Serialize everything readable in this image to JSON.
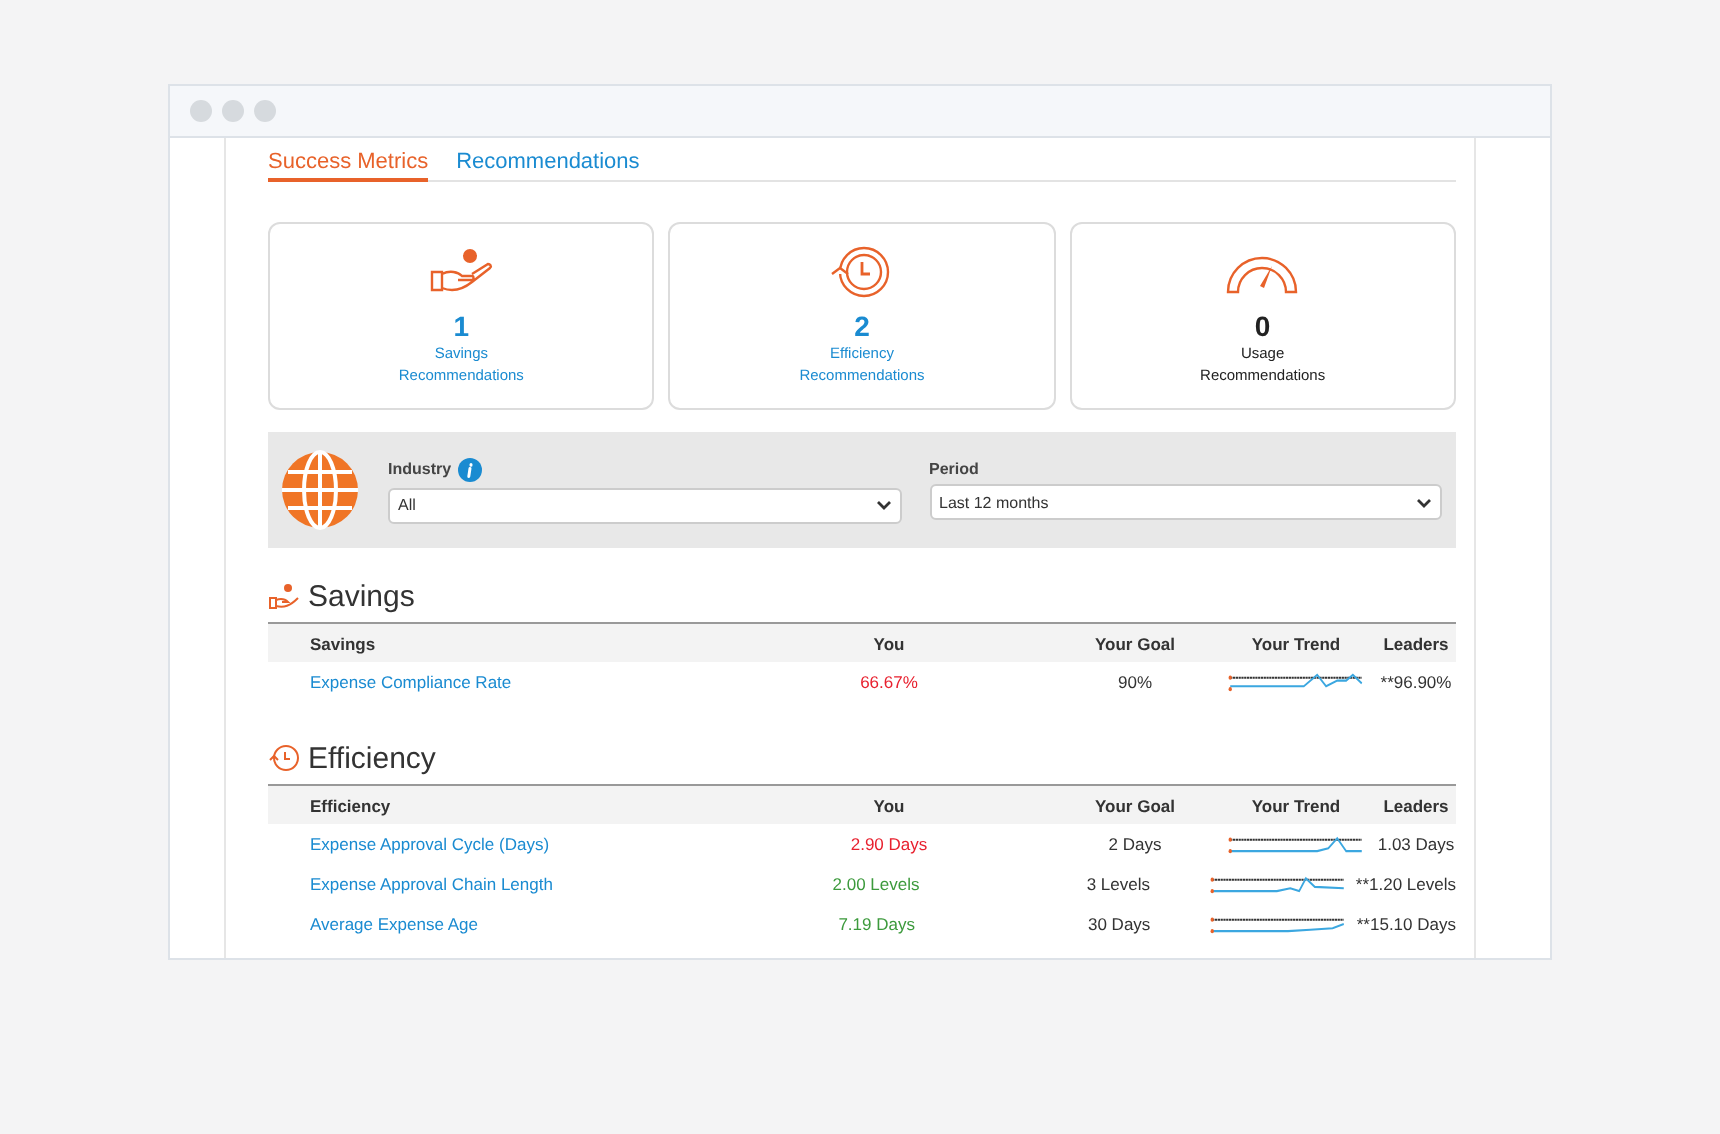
{
  "tabs": [
    {
      "label": "Success Metrics",
      "selected": true
    },
    {
      "label": "Recommendations",
      "selected": false
    }
  ],
  "cards": [
    {
      "kind": "savings",
      "count": "1",
      "line1": "Savings",
      "line2": "Recommendations",
      "highlight": true
    },
    {
      "kind": "efficiency",
      "count": "2",
      "line1": "Efficiency",
      "line2": "Recommendations",
      "highlight": true
    },
    {
      "kind": "usage",
      "count": "0",
      "line1": "Usage",
      "line2": "Recommendations",
      "highlight": false
    }
  ],
  "filters": [
    {
      "label": "Industry",
      "info": true,
      "value": "All"
    },
    {
      "label": "Period",
      "info": false,
      "value": "Last 12 months"
    }
  ],
  "sections": [
    {
      "kind": "savings",
      "title": "Savings",
      "columns": [
        "Savings",
        "You",
        "Your Goal",
        "Your Trend",
        "Leaders"
      ],
      "rows": [
        {
          "metric": "Expense Compliance Rate",
          "you": "66.67%",
          "color": "#e8202e",
          "goal": "90%",
          "leaders": "**96.90%"
        }
      ]
    },
    {
      "kind": "efficiency",
      "title": "Efficiency",
      "columns": [
        "Efficiency",
        "You",
        "Your Goal",
        "Your Trend",
        "Leaders"
      ],
      "rows": [
        {
          "metric": "Expense Approval Cycle (Days)",
          "you": "2.90 Days",
          "color": "#e8202e",
          "goal": "2 Days",
          "leaders": "1.03 Days"
        },
        {
          "metric": "Expense Approval Chain Length",
          "you": "2.00 Levels",
          "color": "#3c9a3c",
          "goal": "3 Levels",
          "leaders": "**1.20 Levels"
        },
        {
          "metric": "Average Expense Age",
          "you": "7.19 Days",
          "color": "#3c9a3c",
          "goal": "30 Days",
          "leaders": "**15.10 Days"
        }
      ]
    }
  ]
}
